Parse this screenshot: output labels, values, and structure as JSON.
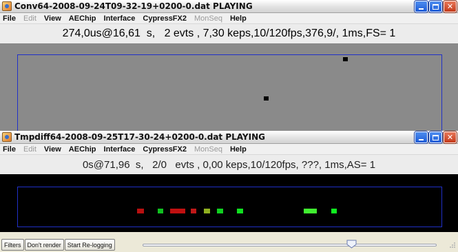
{
  "window1": {
    "title": "Conv64-2008-09-24T09-32-19+0200-0.dat PLAYING",
    "status": "274,0us@16,61  s,   2 evts , 7,30 keps,10/120fps,376,9/, 1ms,FS= 1"
  },
  "window2": {
    "title": "Tmpdiff64-2008-09-25T17-30-24+0200-0.dat PLAYING",
    "status": "0s@71,96  s,   2/0   evts , 0,00 keps,10/120fps, ???, 1ms,AS= 1"
  },
  "menu": [
    {
      "label": "File",
      "enabled": true
    },
    {
      "label": "Edit",
      "enabled": false
    },
    {
      "label": "View",
      "enabled": true
    },
    {
      "label": "AEChip",
      "enabled": true
    },
    {
      "label": "Interface",
      "enabled": true
    },
    {
      "label": "CypressFX2",
      "enabled": true
    },
    {
      "label": "MonSeq",
      "enabled": false
    },
    {
      "label": "Help",
      "enabled": true
    }
  ],
  "bottom": {
    "filters_label": "Filters",
    "dont_render_label": "Don't render",
    "relogging_label": "Start Re-logging",
    "slider_fraction": 0.71
  },
  "colors": {
    "frame": "#2030c8",
    "event_red": "#c01010",
    "event_green": "#10e020",
    "event_olive": "#a0c020"
  },
  "icons": {
    "app": "java-coffee-icon",
    "minimize": "minimize-icon",
    "maximize": "maximize-icon",
    "close": "close-icon"
  }
}
